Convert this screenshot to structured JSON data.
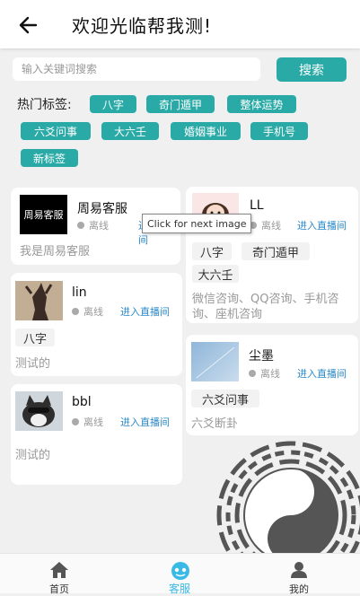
{
  "header": {
    "title": "欢迎光临帮我测!"
  },
  "search": {
    "placeholder": "输入关键词搜索",
    "button": "搜索"
  },
  "tags": {
    "label": "热门标签:",
    "items": [
      "八字",
      "奇门遁甲",
      "整体运势",
      "六爻问事",
      "大六壬",
      "婚姻事业",
      "手机号",
      "新标签"
    ]
  },
  "tooltip": "Click for next image",
  "cards": [
    {
      "name": "周易客服",
      "avatar_text": "周易客服",
      "status": "离线",
      "live": "进入直播间",
      "tags": [],
      "desc": "我是周易客服"
    },
    {
      "name": "LL",
      "status": "离线",
      "live": "进入直播间",
      "tags": [
        "八字",
        "奇门遁甲",
        "大六壬"
      ],
      "desc": "微信咨询、QQ咨询、手机咨询、座机咨询"
    },
    {
      "name": "lin",
      "status": "离线",
      "live": "进入直播间",
      "tags": [
        "八字"
      ],
      "desc": "测试的"
    },
    {
      "name": "尘墨",
      "status": "离线",
      "live": "进入直播间",
      "tags": [
        "六爻问事"
      ],
      "desc": "六爻断卦"
    },
    {
      "name": "bbl",
      "status": "离线",
      "live": "进入直播间",
      "tags": [],
      "desc": "测试的"
    }
  ],
  "tabs": [
    {
      "label": "首页",
      "icon": "home-icon"
    },
    {
      "label": "客服",
      "icon": "service-icon",
      "active": true
    },
    {
      "label": "我的",
      "icon": "user-icon"
    }
  ],
  "colors": {
    "accent": "#2aaaa6",
    "link": "#2a88c8",
    "tab_active": "#39b9e6"
  }
}
